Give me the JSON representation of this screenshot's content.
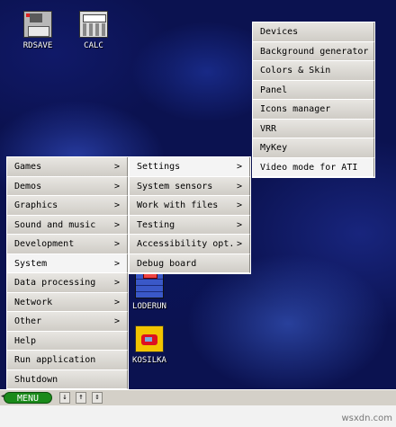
{
  "desktop": {
    "icons": [
      {
        "label": "RDSAVE",
        "icon": "drive-icon"
      },
      {
        "label": "CALC",
        "icon": "calculator-icon"
      },
      {
        "label": "LODERUN",
        "icon": "loderunner-icon"
      },
      {
        "label": "KOSILKA",
        "icon": "mower-icon"
      }
    ]
  },
  "main_menu": {
    "items": [
      {
        "label": "Games",
        "arrow": ">"
      },
      {
        "label": "Demos",
        "arrow": ">"
      },
      {
        "label": "Graphics",
        "arrow": ">"
      },
      {
        "label": "Sound and music",
        "arrow": ">"
      },
      {
        "label": "Development",
        "arrow": ">"
      },
      {
        "label": "System",
        "arrow": ">"
      },
      {
        "label": "Data processing",
        "arrow": ">"
      },
      {
        "label": "Network",
        "arrow": ">"
      },
      {
        "label": "Other",
        "arrow": ">"
      },
      {
        "label": "Help"
      },
      {
        "label": "Run application"
      },
      {
        "label": "Shutdown"
      }
    ]
  },
  "system_menu": {
    "items": [
      {
        "label": "Settings",
        "arrow": ">"
      },
      {
        "label": "System sensors",
        "arrow": ">"
      },
      {
        "label": "Work with files",
        "arrow": ">"
      },
      {
        "label": "Testing",
        "arrow": ">"
      },
      {
        "label": "Accessibility opt.",
        "arrow": ">"
      },
      {
        "label": "Debug board"
      }
    ]
  },
  "settings_menu": {
    "items": [
      {
        "label": "Devices"
      },
      {
        "label": "Background generator"
      },
      {
        "label": "Colors & Skin"
      },
      {
        "label": "Panel"
      },
      {
        "label": "Icons manager"
      },
      {
        "label": "VRR"
      },
      {
        "label": "MyKey"
      },
      {
        "label": "Video mode for ATI"
      }
    ]
  },
  "taskbar": {
    "left_arrow": "◂",
    "menu_label": "MENU",
    "down_arrow": "↓",
    "up_arrow": "↑",
    "updown_arrow": "⇕"
  },
  "watermark": "wsxdn.com",
  "colors": {
    "menu_button": "#1a8a1a",
    "wallpaper": "#0b1250",
    "menu_bg": "#d4d0c8"
  }
}
